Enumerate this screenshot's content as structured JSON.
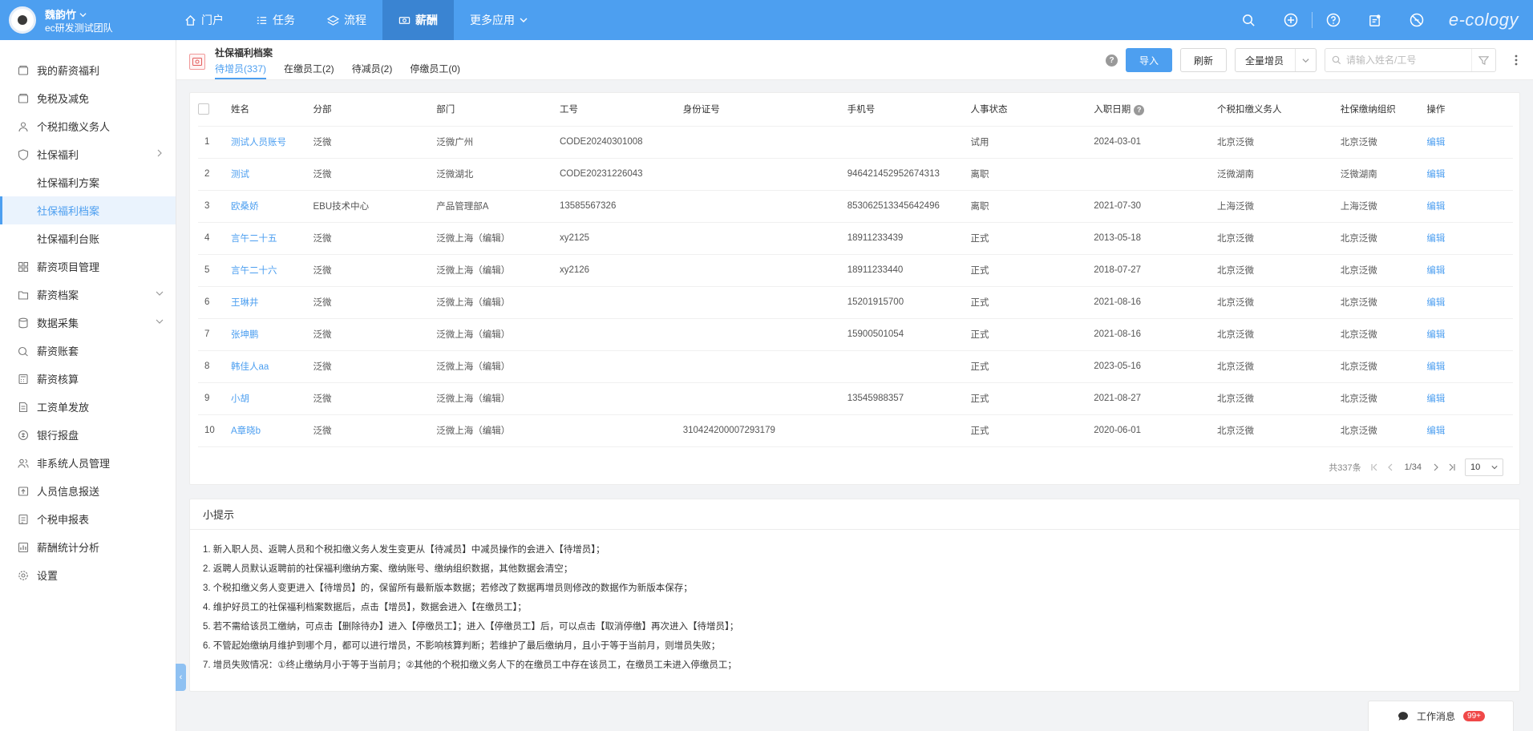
{
  "header": {
    "user_name": "魏韵竹",
    "team": "ec研发测试团队",
    "nav": [
      {
        "label": "门户",
        "icon": "home-icon"
      },
      {
        "label": "任务",
        "icon": "list-icon"
      },
      {
        "label": "流程",
        "icon": "layers-icon"
      },
      {
        "label": "薪酬",
        "icon": "money-icon",
        "active": true
      },
      {
        "label": "更多应用",
        "icon": "chevron-down-icon"
      }
    ],
    "brand_text": "e-cology",
    "accent_color": "#4d9ff0"
  },
  "sidebar": {
    "items": [
      {
        "label": "我的薪资福利",
        "icon": "wallet-icon"
      },
      {
        "label": "免税及减免",
        "icon": "wallet-icon"
      },
      {
        "label": "个税扣缴义务人",
        "icon": "person-icon"
      },
      {
        "label": "社保福利",
        "icon": "shield-icon",
        "expanded": true
      },
      {
        "label": "社保福利方案",
        "sub": true
      },
      {
        "label": "社保福利档案",
        "sub": true,
        "active": true
      },
      {
        "label": "社保福利台账",
        "sub": true
      },
      {
        "label": "薪资项目管理",
        "icon": "grid-icon"
      },
      {
        "label": "薪资档案",
        "icon": "folder-icon",
        "collapsible": true
      },
      {
        "label": "数据采集",
        "icon": "database-icon",
        "collapsible": true
      },
      {
        "label": "薪资账套",
        "icon": "ledger-icon"
      },
      {
        "label": "薪资核算",
        "icon": "calculator-icon"
      },
      {
        "label": "工资单发放",
        "icon": "document-icon"
      },
      {
        "label": "银行报盘",
        "icon": "bank-icon"
      },
      {
        "label": "非系统人员管理",
        "icon": "people-icon"
      },
      {
        "label": "人员信息报送",
        "icon": "upload-icon"
      },
      {
        "label": "个税申报表",
        "icon": "report-icon"
      },
      {
        "label": "薪酬统计分析",
        "icon": "chart-icon"
      },
      {
        "label": "设置",
        "icon": "gear-icon"
      }
    ]
  },
  "page": {
    "title": "社保福利档案",
    "tabs": [
      {
        "label": "待增员(337)",
        "active": true
      },
      {
        "label": "在缴员工(2)"
      },
      {
        "label": "待减员(2)"
      },
      {
        "label": "停缴员工(0)"
      }
    ],
    "toolbar": {
      "help": "?",
      "import_label": "导入",
      "refresh_label": "刷新",
      "select_value": "全量增员",
      "search_placeholder": "请输入姓名/工号"
    }
  },
  "table": {
    "columns": [
      "姓名",
      "分部",
      "部门",
      "工号",
      "身份证号",
      "手机号",
      "人事状态",
      "入职日期",
      "个税扣缴义务人",
      "社保缴纳组织",
      "操作"
    ],
    "rows": [
      {
        "no": "1",
        "name": "测试人员账号",
        "branch": "泛微",
        "dept": "泛微广州",
        "code": "CODE20240301008",
        "id": "",
        "phone": "",
        "status": "试用",
        "date": "2024-03-01",
        "withholder": "北京泛微",
        "org": "北京泛微",
        "op": "编辑"
      },
      {
        "no": "2",
        "name": "测试",
        "branch": "泛微",
        "dept": "泛微湖北",
        "code": "CODE20231226043",
        "id": "",
        "phone": "946421452952674313",
        "status": "离职",
        "date": "",
        "withholder": "泛微湖南",
        "org": "泛微湖南",
        "op": "编辑"
      },
      {
        "no": "3",
        "name": "欧桑娇",
        "branch": "EBU技术中心",
        "dept": "产品管理部A",
        "code": "13585567326",
        "id": "",
        "phone": "853062513345642496",
        "status": "离职",
        "date": "2021-07-30",
        "withholder": "上海泛微",
        "org": "上海泛微",
        "op": "编辑"
      },
      {
        "no": "4",
        "name": "言午二十五",
        "branch": "泛微",
        "dept": "泛微上海（编辑）",
        "code": "xy2125",
        "id": "",
        "phone": "18911233439",
        "status": "正式",
        "date": "2013-05-18",
        "withholder": "北京泛微",
        "org": "北京泛微",
        "op": "编辑"
      },
      {
        "no": "5",
        "name": "言午二十六",
        "branch": "泛微",
        "dept": "泛微上海（编辑）",
        "code": "xy2126",
        "id": "",
        "phone": "18911233440",
        "status": "正式",
        "date": "2018-07-27",
        "withholder": "北京泛微",
        "org": "北京泛微",
        "op": "编辑"
      },
      {
        "no": "6",
        "name": "王琳井",
        "branch": "泛微",
        "dept": "泛微上海（编辑）",
        "code": "",
        "id": "",
        "phone": "15201915700",
        "status": "正式",
        "date": "2021-08-16",
        "withholder": "北京泛微",
        "org": "北京泛微",
        "op": "编辑"
      },
      {
        "no": "7",
        "name": "张坤鹏",
        "branch": "泛微",
        "dept": "泛微上海（编辑）",
        "code": "",
        "id": "",
        "phone": "15900501054",
        "status": "正式",
        "date": "2021-08-16",
        "withholder": "北京泛微",
        "org": "北京泛微",
        "op": "编辑"
      },
      {
        "no": "8",
        "name": "韩佳人aa",
        "branch": "泛微",
        "dept": "泛微上海（编辑）",
        "code": "",
        "id": "",
        "phone": "",
        "status": "正式",
        "date": "2023-05-16",
        "withholder": "北京泛微",
        "org": "北京泛微",
        "op": "编辑"
      },
      {
        "no": "9",
        "name": "小胡",
        "branch": "泛微",
        "dept": "泛微上海（编辑）",
        "code": "",
        "id": "",
        "phone": "13545988357",
        "status": "正式",
        "date": "2021-08-27",
        "withholder": "北京泛微",
        "org": "北京泛微",
        "op": "编辑"
      },
      {
        "no": "10",
        "name": "A章晓b",
        "branch": "泛微",
        "dept": "泛微上海（编辑）",
        "code": "",
        "id": "310424200007293179",
        "phone": "",
        "status": "正式",
        "date": "2020-06-01",
        "withholder": "北京泛微",
        "org": "北京泛微",
        "op": "编辑"
      }
    ],
    "pagination": {
      "total": "共337条",
      "page": "1/34",
      "page_size": "10"
    }
  },
  "tips": {
    "title": "小提示",
    "lines": [
      "1. 新入职人员、返聘人员和个税扣缴义务人发生变更从【待减员】中减员操作的会进入【待增员】；",
      "2. 返聘人员默认返聘前的社保福利缴纳方案、缴纳账号、缴纳组织数据，其他数据会清空；",
      "3. 个税扣缴义务人变更进入【待增员】的，保留所有最新版本数据；若修改了数据再增员则修改的数据作为新版本保存；",
      "4. 维护好员工的社保福利档案数据后，点击【增员】，数据会进入【在缴员工】；",
      "5. 若不需给该员工缴纳，可点击【删除待办】进入【停缴员工】；进入【停缴员工】后，可以点击【取消停缴】再次进入【待增员】；",
      "6. 不管起始缴纳月维护到哪个月，都可以进行增员，不影响核算判断；若维护了最后缴纳月，且小于等于当前月，则增员失败；",
      "7. 增员失败情况：①终止缴纳月小于等于当前月；②其他的个税扣缴义务人下的在缴员工中存在该员工，在缴员工未进入停缴员工；"
    ]
  },
  "messages": {
    "label": "工作消息",
    "badge": "99+"
  }
}
